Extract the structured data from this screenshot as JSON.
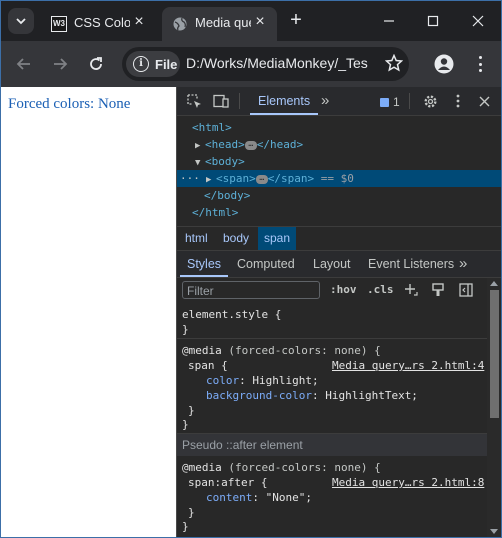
{
  "browser": {
    "tabs": [
      {
        "favicon": "W3",
        "title": "CSS Colors"
      },
      {
        "favicon": "globe-icon",
        "title": "Media query"
      }
    ],
    "address": {
      "scheme_chip": "File",
      "url": "D:/Works/MediaMonkey/_Tes"
    }
  },
  "page": {
    "text": "Forced colors: None"
  },
  "devtools": {
    "tabs": {
      "elements": "Elements",
      "more": "»"
    },
    "issues_count": "1",
    "dom": {
      "html_open": "<html>",
      "head_open": "<head>",
      "head_close": "</head>",
      "body_open": "<body>",
      "span_open": "<span>",
      "span_close": "</span>",
      "sel_marker": "== $0",
      "body_close": "</body>",
      "html_close": "</html>",
      "dots": "···"
    },
    "breadcrumbs": [
      "html",
      "body",
      "span"
    ],
    "style_tabs": [
      "Styles",
      "Computed",
      "Layout",
      "Event Listeners"
    ],
    "filter_placeholder": "Filter",
    "hov": ":hov",
    "cls": ".cls",
    "rules": {
      "element_style": "element.style {",
      "close_brace": "}",
      "media_kw": "@media",
      "media_cond": "(forced-colors: none) {",
      "span_sel": "span {",
      "src1": "Media query…rs 2.html:4",
      "p1": "color",
      "v1": "Highlight;",
      "p2": "background-color",
      "v2": "HighlightText;",
      "pseudo_header": "Pseudo ::after element",
      "after_sel": "span:after {",
      "src2": "Media query…rs 2.html:8",
      "p3": "content",
      "v3": "\"None\";"
    }
  },
  "colors": {
    "accent": "#a8c7fa",
    "selection": "#004a77",
    "page_link": "#1a5fb4"
  }
}
